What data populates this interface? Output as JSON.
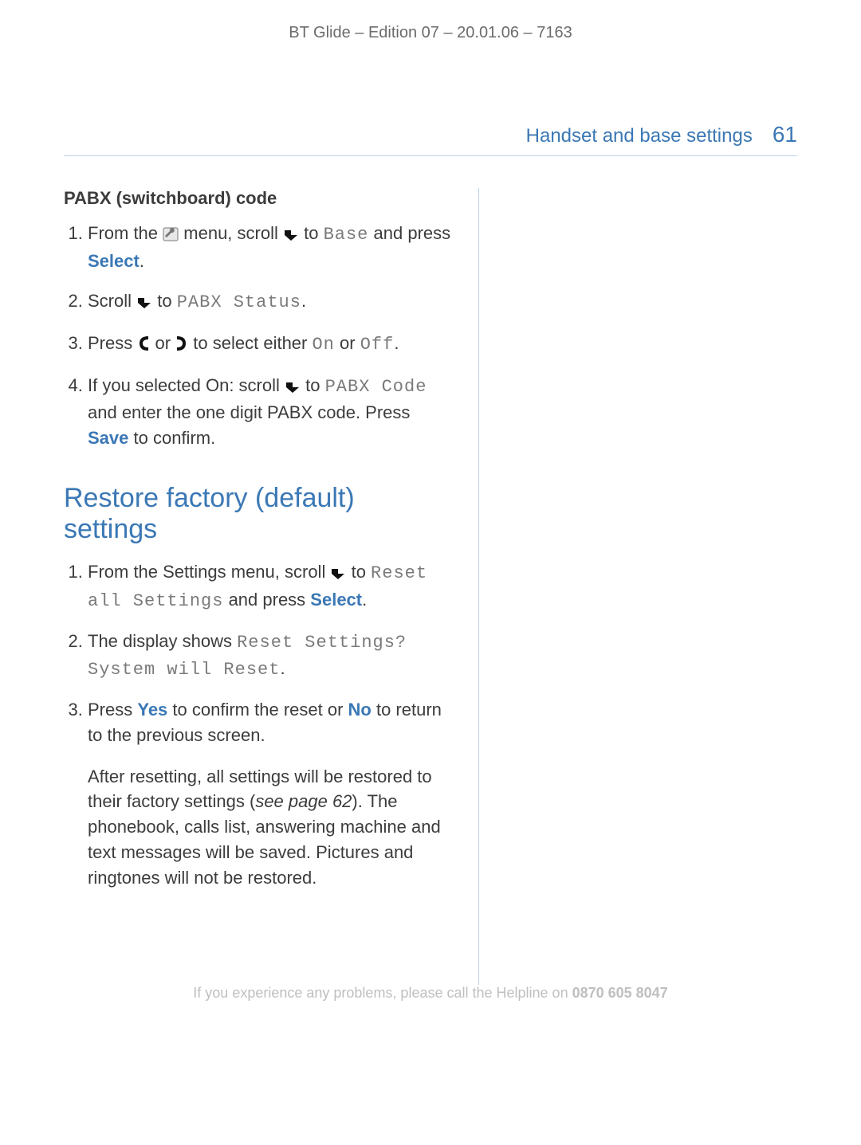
{
  "doc_header": "BT Glide – Edition 07 – 20.01.06 – 7163",
  "runhead": {
    "title": "Handset and base settings",
    "page": "61"
  },
  "pabx": {
    "heading": "PABX (switchboard) code",
    "s1a": "From the ",
    "s1b": " menu, scroll ",
    "s1c": " to ",
    "s1d": "Base",
    "s1e": " and press ",
    "s1f": "Select",
    "s1g": ".",
    "s2a": "Scroll ",
    "s2b": " to ",
    "s2c": "PABX Status",
    "s2d": ".",
    "s3a": "Press ",
    "s3b": " or ",
    "s3c": " to select either ",
    "s3d": "On",
    "s3e": " or ",
    "s3f": "Off",
    "s3g": ".",
    "s4a": "If you selected On: scroll ",
    "s4b": " to ",
    "s4c": "PABX Code",
    "s4d": " and enter the one digit PABX code. Press ",
    "s4e": "Save",
    "s4f": " to confirm."
  },
  "restore": {
    "heading": "Restore factory (default) settings",
    "s1a": "From the Settings menu, scroll ",
    "s1b": " to ",
    "s1c": "Reset all Settings",
    "s1d": " and press ",
    "s1e": "Select",
    "s1f": ".",
    "s2a": "The display shows ",
    "s2b": "Reset Settings? System will Reset",
    "s2c": ".",
    "s3a": "Press ",
    "s3b": "Yes",
    "s3c": " to confirm the reset or ",
    "s3d": "No",
    "s3e": " to return to the previous screen.",
    "noteA": "After resetting, all settings will be restored to their factory settings (",
    "noteB": "see page 62",
    "noteC": "). The phonebook, calls list, answering machine and text messages will be saved. Pictures and ringtones will not be restored."
  },
  "footer": {
    "text": "If you experience any problems, please call the Helpline on ",
    "phone": "0870 605 8047"
  }
}
